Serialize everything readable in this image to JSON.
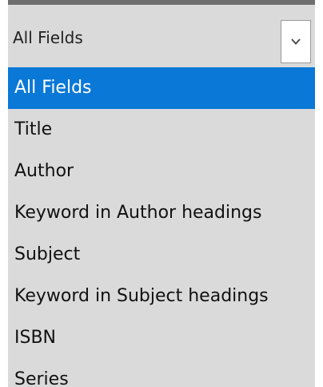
{
  "field_select": {
    "selected_value": "All Fields",
    "arrow_icon": "chevron-down-icon",
    "options": [
      {
        "label": "All Fields",
        "selected": true
      },
      {
        "label": "Title"
      },
      {
        "label": "Author"
      },
      {
        "label": "Keyword in Author headings"
      },
      {
        "label": "Subject"
      },
      {
        "label": "Keyword in Subject headings"
      },
      {
        "label": "ISBN"
      },
      {
        "label": "Series"
      }
    ]
  },
  "colors": {
    "highlight": "#0a78d7",
    "dropdown_bg": "#dadada",
    "top_bar": "#6f6f6f"
  }
}
